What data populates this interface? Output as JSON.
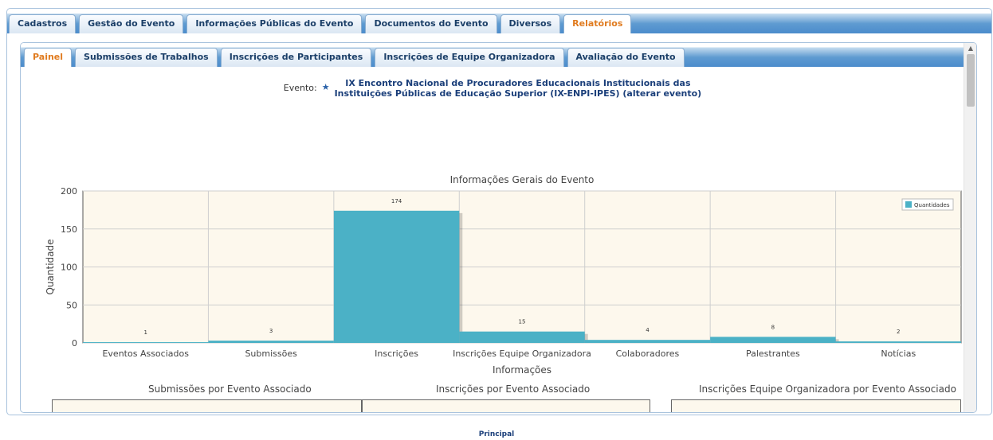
{
  "top_tabs": [
    {
      "label": "Cadastros",
      "active": false
    },
    {
      "label": "Gestão do Evento",
      "active": false
    },
    {
      "label": "Informações Públicas do Evento",
      "active": false
    },
    {
      "label": "Documentos do Evento",
      "active": false
    },
    {
      "label": "Diversos",
      "active": false
    },
    {
      "label": "Relatórios",
      "active": true
    }
  ],
  "sub_tabs": [
    {
      "label": "Painel",
      "active": true
    },
    {
      "label": "Submissões de Trabalhos",
      "active": false
    },
    {
      "label": "Inscrições de Participantes",
      "active": false
    },
    {
      "label": "Inscrições de Equipe Organizadora",
      "active": false
    },
    {
      "label": "Avaliação do Evento",
      "active": false
    }
  ],
  "event": {
    "label": "Evento:",
    "name_line1": "IX Encontro Nacional de Procuradores Educacionais Institucionais das",
    "name_line2": "Instituições Públicas de Educação Superior (IX-ENPI-IPES) (alterar evento)"
  },
  "chart_data": {
    "type": "bar",
    "title": "Informações Gerais do Evento",
    "xlabel": "Informações",
    "ylabel": "Quantidade",
    "ylim": [
      0,
      200
    ],
    "yticks": [
      0,
      50,
      100,
      150,
      200
    ],
    "categories": [
      "Eventos Associados",
      "Submissões",
      "Inscrições",
      "Inscrições Equipe Organizadora",
      "Colaboradores",
      "Palestrantes",
      "Notícias"
    ],
    "series": [
      {
        "name": "Quantidades",
        "values": [
          1,
          3,
          174,
          15,
          4,
          8,
          2
        ]
      }
    ],
    "legend": "top-right",
    "grid": true,
    "bar_color": "#4bb1c6",
    "plot_bg": "#fdf8ed"
  },
  "bottom_titles": {
    "submissoes": "Submissões por Evento Associado",
    "inscricoes": "Inscrições por Evento Associado",
    "equipe": "Inscrições Equipe Organizadora por Evento Associado"
  },
  "footer": {
    "link": "Principal"
  }
}
